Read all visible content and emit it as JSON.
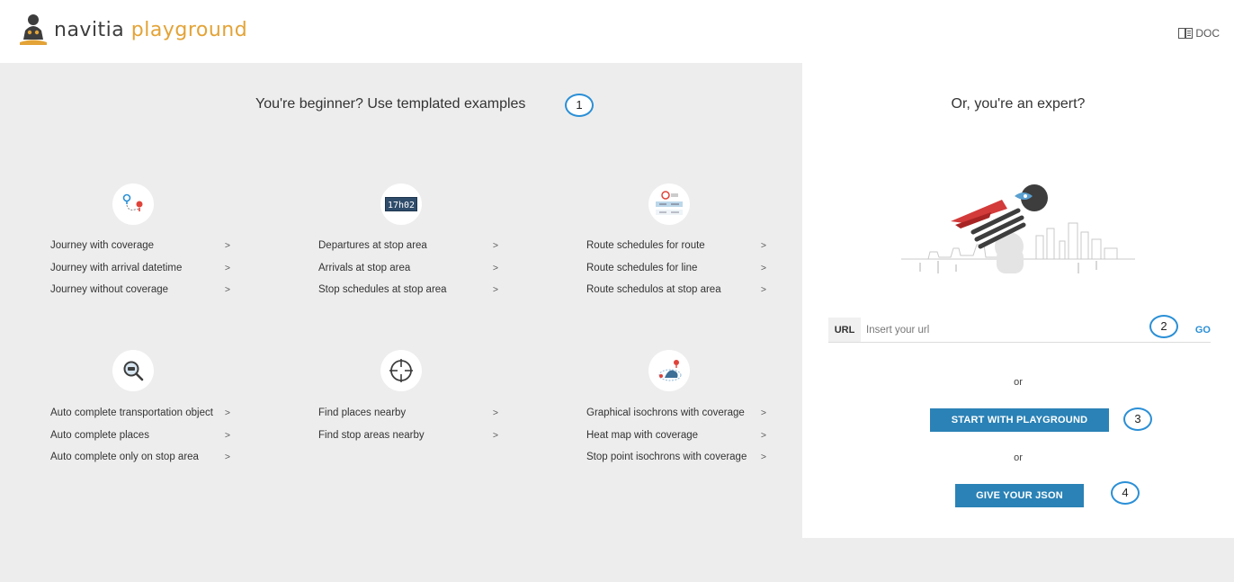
{
  "header": {
    "logo_word1": "navitia",
    "logo_word2": "playground",
    "doc_label": "DOC"
  },
  "beginner": {
    "title": "You're beginner? Use templated examples",
    "badge": "1",
    "categories": [
      {
        "icon": "journey-icon",
        "links": [
          "Journey with coverage",
          "Journey with arrival datetime",
          "Journey without coverage"
        ]
      },
      {
        "icon": "departures-board-icon",
        "icon_text": "17h02",
        "links": [
          "Departures at stop area",
          "Arrivals at stop area",
          "Stop schedules at stop area"
        ]
      },
      {
        "icon": "route-schedule-icon",
        "links": [
          "Route schedules for route",
          "Route schedules for line",
          "Route schedulos at stop area"
        ]
      },
      {
        "icon": "autocomplete-search-icon",
        "links": [
          "Auto complete transportation object",
          "Auto complete places",
          "Auto complete only on stop area"
        ]
      },
      {
        "icon": "crosshair-icon",
        "links": [
          "Find places nearby",
          "Find stop areas nearby"
        ]
      },
      {
        "icon": "isochron-map-icon",
        "links": [
          "Graphical isochrons with coverage",
          "Heat map with coverage",
          "Stop point isochrons with coverage"
        ]
      }
    ],
    "arrow": ">"
  },
  "expert": {
    "title": "Or, you're an expert?",
    "url_label": "URL",
    "url_placeholder": "Insert your url",
    "url_value": "",
    "go_label": "GO",
    "badge_url": "2",
    "or_1": "or",
    "start_label": "START WITH PLAYGROUND",
    "badge_start": "3",
    "or_2": "or",
    "json_label": "GIVE YOUR JSON",
    "badge_json": "4"
  },
  "colors": {
    "accent_blue": "#2a82b6",
    "badge_blue": "#2a8fd6",
    "logo_orange": "#e3a336",
    "background": "#ededed"
  }
}
